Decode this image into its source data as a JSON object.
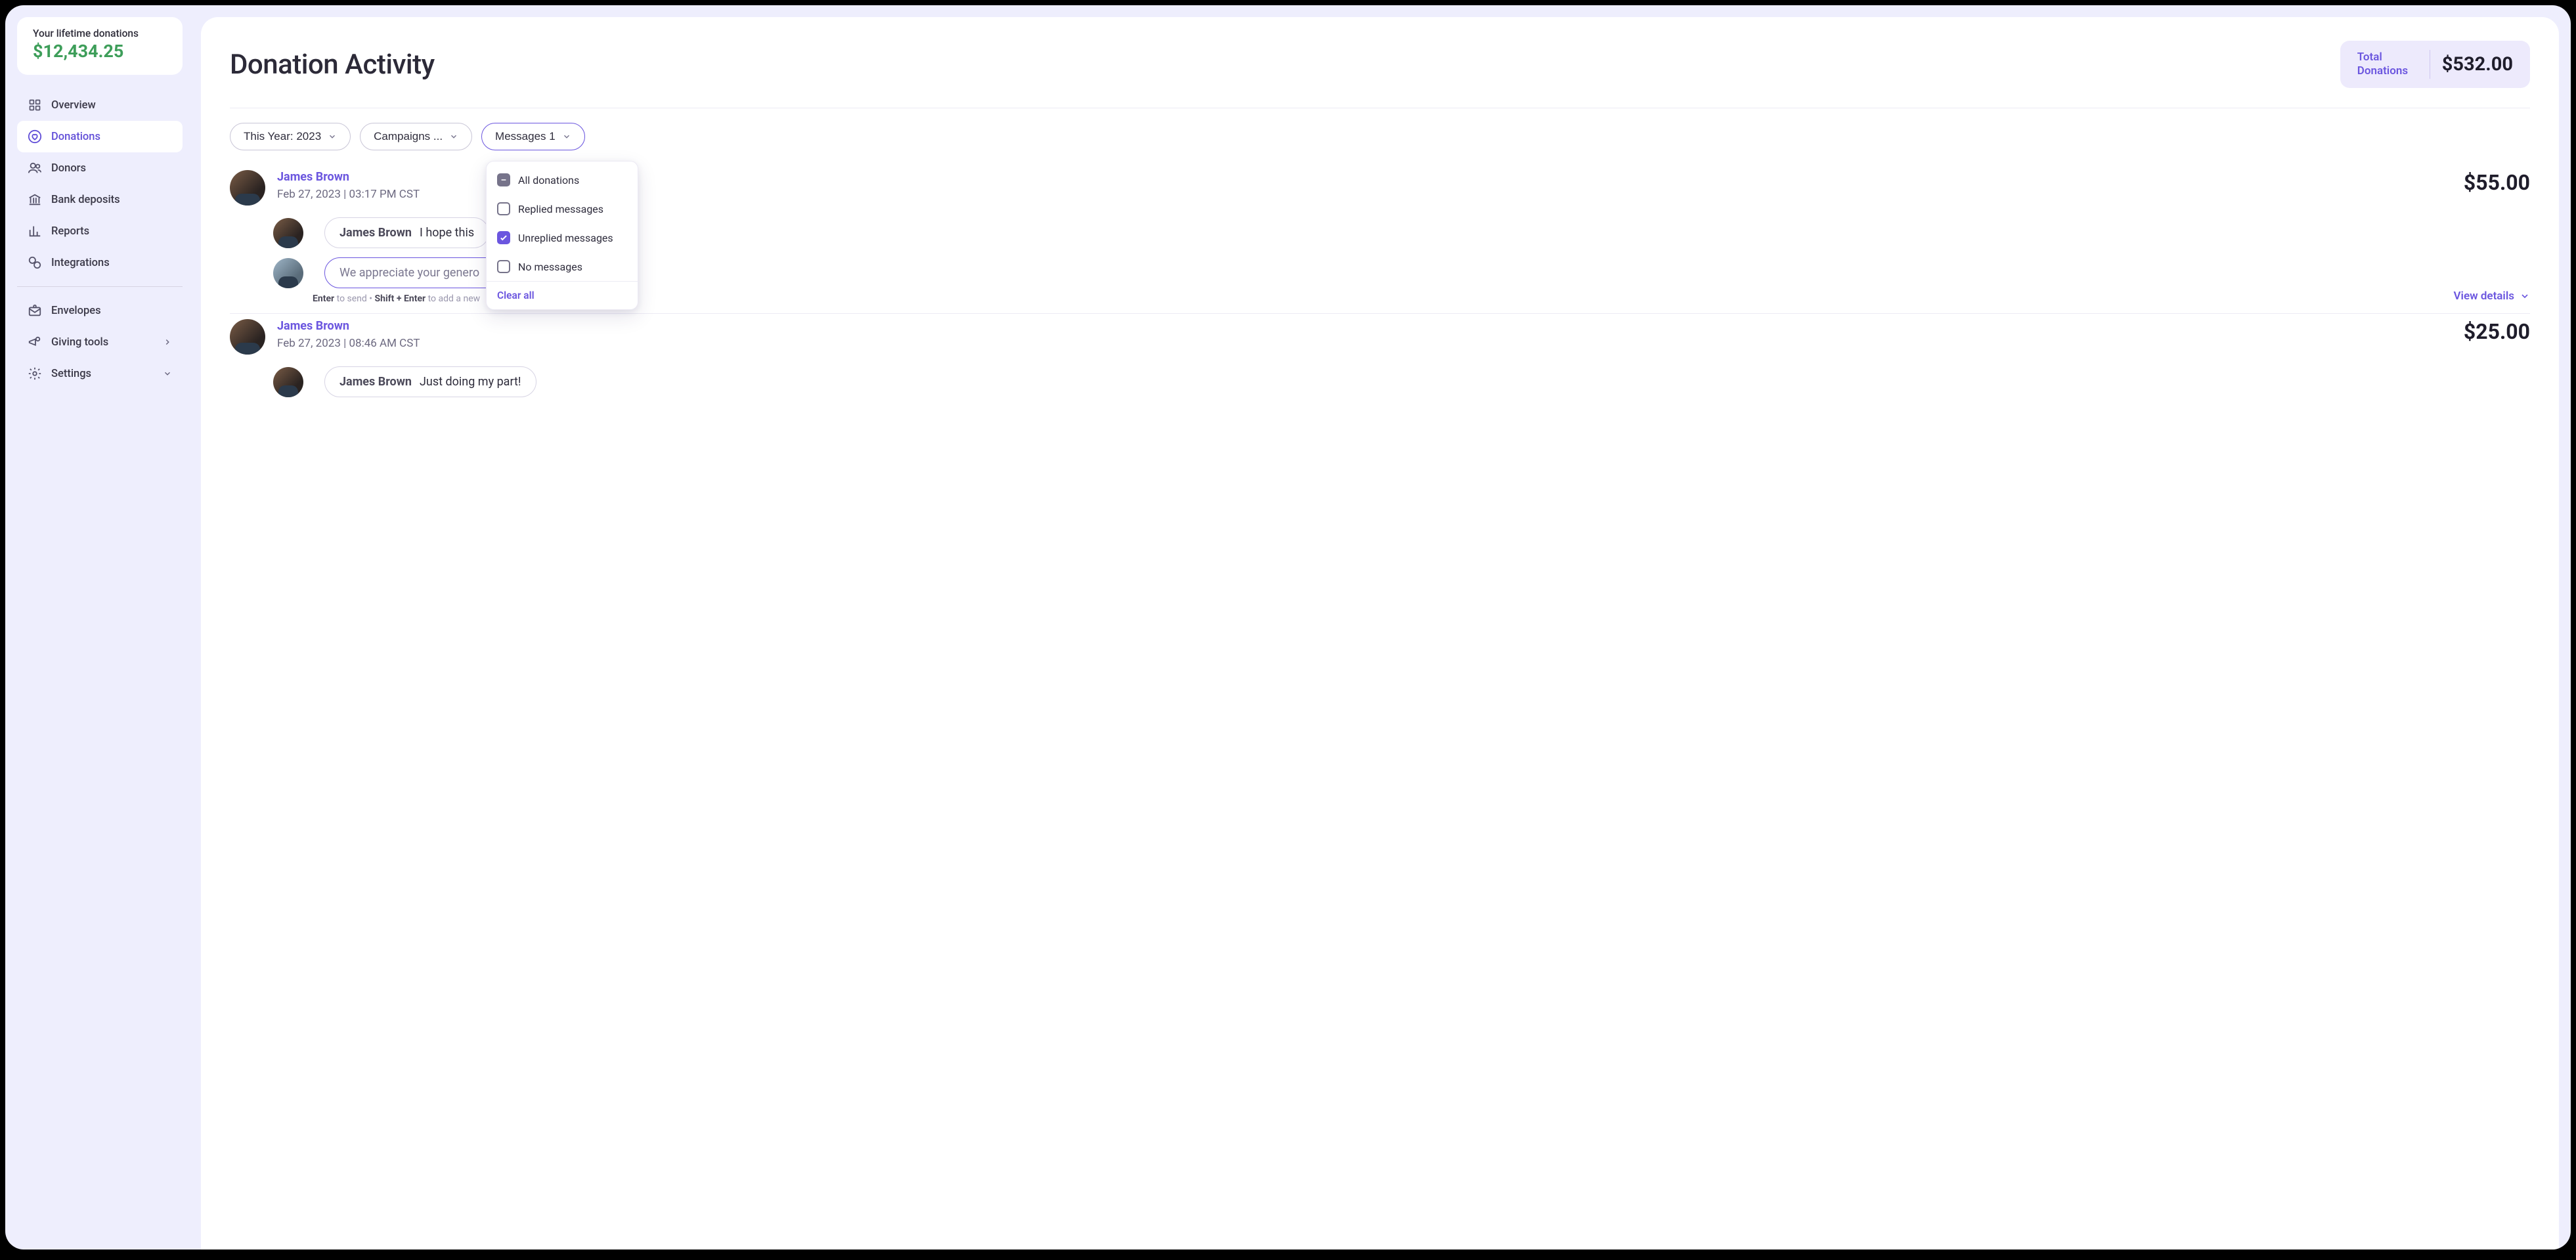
{
  "sidebar": {
    "lifetime": {
      "label": "Your lifetime donations",
      "amount": "$12,434.25"
    },
    "items": [
      {
        "label": "Overview"
      },
      {
        "label": "Donations"
      },
      {
        "label": "Donors"
      },
      {
        "label": "Bank deposits"
      },
      {
        "label": "Reports"
      },
      {
        "label": "Integrations"
      }
    ],
    "bottom": [
      {
        "label": "Envelopes"
      },
      {
        "label": "Giving tools"
      },
      {
        "label": "Settings"
      }
    ]
  },
  "header": {
    "title": "Donation Activity",
    "total_label": "Total Donations",
    "total_amount": "$532.00"
  },
  "filters": {
    "year": "This Year: 2023",
    "campaigns": "Campaigns ...",
    "messages": "Messages 1"
  },
  "dropdown": {
    "all": "All donations",
    "replied": "Replied messages",
    "unreplied": "Unreplied messages",
    "none": "No messages",
    "clear": "Clear all"
  },
  "activity": [
    {
      "name": "James Brown",
      "time": "Feb 27, 2023 | 03:17 PM CST",
      "amount": "$55.00",
      "message": {
        "sender": "James Brown",
        "text": "I hope this"
      },
      "reply_placeholder": "We appreciate your genero",
      "hint": {
        "enter": "Enter",
        "send": " to send • ",
        "shift": "Shift + Enter",
        "rest": " to add a new"
      },
      "view_details": "View details"
    },
    {
      "name": "James Brown",
      "time": "Feb 27, 2023 | 08:46 AM CST",
      "amount": "$25.00",
      "message": {
        "sender": "James Brown",
        "text": "Just doing my part!"
      }
    }
  ]
}
